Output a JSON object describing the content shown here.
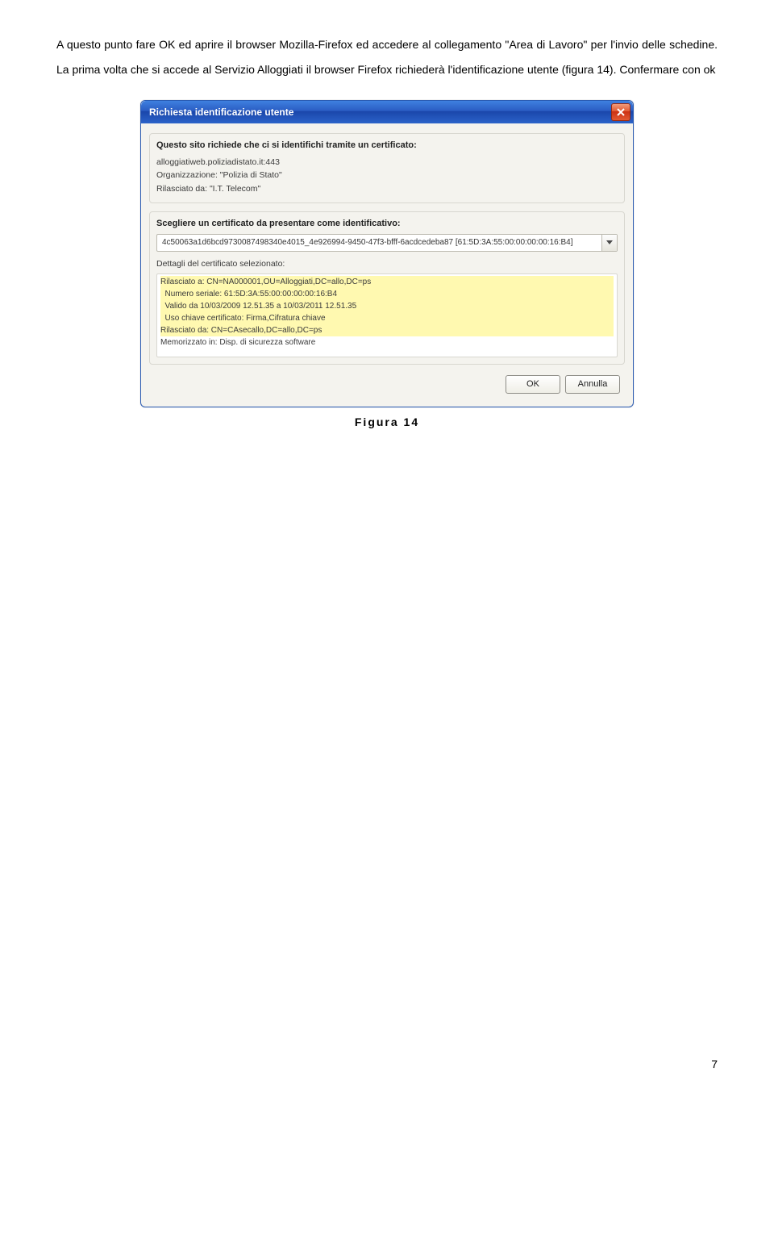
{
  "paragraph": "A questo punto fare OK ed aprire il browser Mozilla-Firefox ed accedere al collegamento \"Area di Lavoro\" per l'invio delle schedine.  La prima volta che si accede al Servizio Alloggiati il browser Firefox richiederà l'identificazione utente (figura 14). Confermare con ok",
  "dialog": {
    "title": "Richiesta identificazione utente",
    "close_icon": "X",
    "group1": {
      "heading": "Questo sito richiede che ci si identifichi tramite un certificato:",
      "line1": "alloggiatiweb.poliziadistato.it:443",
      "line2": "Organizzazione: \"Polizia di Stato\"",
      "line3": "Rilasciato da: \"I.T. Telecom\""
    },
    "group2": {
      "heading": "Scegliere un certificato da presentare come identificativo:",
      "combo_value": "4c50063a1d6bcd9730087498340e4015_4e926994-9450-47f3-bfff-6acdcedeba87 [61:5D:3A:55:00:00:00:00:16:B4]",
      "details_label": "Dettagli del certificato selezionato:",
      "details": {
        "l1": "Rilasciato a: CN=NA000001,OU=Alloggiati,DC=allo,DC=ps",
        "l2": "  Numero seriale: 61:5D:3A:55:00:00:00:00:16:B4",
        "l3": "  Valido da 10/03/2009 12.51.35 a 10/03/2011 12.51.35",
        "l4": "  Uso chiave certificato: Firma,Cifratura chiave",
        "l5": "Rilasciato da: CN=CAsecallo,DC=allo,DC=ps",
        "l6": "Memorizzato in: Disp. di sicurezza software"
      }
    },
    "ok": "OK",
    "cancel": "Annulla"
  },
  "caption": "Figura 14",
  "page_number": "7"
}
